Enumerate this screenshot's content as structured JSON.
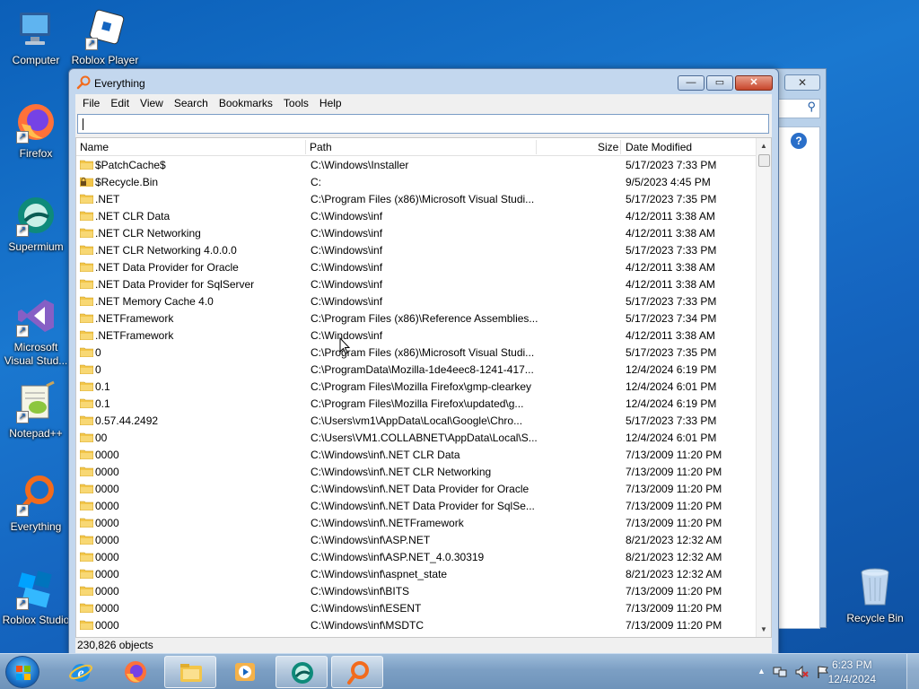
{
  "desktop": {
    "icons": [
      {
        "label": "Computer",
        "icon": "computer-icon"
      },
      {
        "label": "Roblox Player",
        "icon": "roblox-player-icon"
      },
      {
        "label": "Firefox",
        "icon": "firefox-icon"
      },
      {
        "label": "Supermium",
        "icon": "supermium-icon"
      },
      {
        "label": "Microsoft Visual Stud...",
        "icon": "visual-studio-icon"
      },
      {
        "label": "Notepad++",
        "icon": "notepadpp-icon"
      },
      {
        "label": "Everything",
        "icon": "everything-icon"
      },
      {
        "label": "Roblox Studio",
        "icon": "roblox-studio-icon"
      },
      {
        "label": "Recycle Bin",
        "icon": "recycle-bin-icon"
      }
    ]
  },
  "window": {
    "title": "Everything",
    "close_glyph": "✕",
    "maximize_glyph": "▭",
    "minimize_glyph": "—"
  },
  "menu": [
    "File",
    "Edit",
    "View",
    "Search",
    "Bookmarks",
    "Tools",
    "Help"
  ],
  "search": {
    "value": ""
  },
  "columns": {
    "name": "Name",
    "path": "Path",
    "size": "Size",
    "date": "Date Modified"
  },
  "rows": [
    {
      "name": "$PatchCache$",
      "path": "C:\\Windows\\Installer",
      "date": "5/17/2023 7:33 PM"
    },
    {
      "name": "$Recycle.Bin",
      "path": "C:",
      "date": "9/5/2023 4:45 PM",
      "locked": true
    },
    {
      "name": ".NET",
      "path": "C:\\Program Files (x86)\\Microsoft Visual Studi...",
      "date": "5/17/2023 7:35 PM"
    },
    {
      "name": ".NET CLR Data",
      "path": "C:\\Windows\\inf",
      "date": "4/12/2011 3:38 AM"
    },
    {
      "name": ".NET CLR Networking",
      "path": "C:\\Windows\\inf",
      "date": "4/12/2011 3:38 AM"
    },
    {
      "name": ".NET CLR Networking 4.0.0.0",
      "path": "C:\\Windows\\inf",
      "date": "5/17/2023 7:33 PM"
    },
    {
      "name": ".NET Data Provider for Oracle",
      "path": "C:\\Windows\\inf",
      "date": "4/12/2011 3:38 AM"
    },
    {
      "name": ".NET Data Provider for SqlServer",
      "path": "C:\\Windows\\inf",
      "date": "4/12/2011 3:38 AM"
    },
    {
      "name": ".NET Memory Cache 4.0",
      "path": "C:\\Windows\\inf",
      "date": "5/17/2023 7:33 PM"
    },
    {
      "name": ".NETFramework",
      "path": "C:\\Program Files (x86)\\Reference Assemblies...",
      "date": "5/17/2023 7:34 PM"
    },
    {
      "name": ".NETFramework",
      "path": "C:\\Windows\\inf",
      "date": "4/12/2011 3:38 AM"
    },
    {
      "name": "0",
      "path": "C:\\Program Files (x86)\\Microsoft Visual Studi...",
      "date": "5/17/2023 7:35 PM"
    },
    {
      "name": "0",
      "path": "C:\\ProgramData\\Mozilla-1de4eec8-1241-417...",
      "date": "12/4/2024 6:19 PM"
    },
    {
      "name": "0.1",
      "path": "C:\\Program Files\\Mozilla Firefox\\gmp-clearkey",
      "date": "12/4/2024 6:01 PM"
    },
    {
      "name": "0.1",
      "path": "C:\\Program Files\\Mozilla Firefox\\updated\\g...",
      "date": "12/4/2024 6:19 PM"
    },
    {
      "name": "0.57.44.2492",
      "path": "C:\\Users\\vm1\\AppData\\Local\\Google\\Chro...",
      "date": "5/17/2023 7:33 PM"
    },
    {
      "name": "00",
      "path": "C:\\Users\\VM1.COLLABNET\\AppData\\Local\\S...",
      "date": "12/4/2024 6:01 PM"
    },
    {
      "name": "0000",
      "path": "C:\\Windows\\inf\\.NET CLR Data",
      "date": "7/13/2009 11:20 PM"
    },
    {
      "name": "0000",
      "path": "C:\\Windows\\inf\\.NET CLR Networking",
      "date": "7/13/2009 11:20 PM"
    },
    {
      "name": "0000",
      "path": "C:\\Windows\\inf\\.NET Data Provider for Oracle",
      "date": "7/13/2009 11:20 PM"
    },
    {
      "name": "0000",
      "path": "C:\\Windows\\inf\\.NET Data Provider for SqlSe...",
      "date": "7/13/2009 11:20 PM"
    },
    {
      "name": "0000",
      "path": "C:\\Windows\\inf\\.NETFramework",
      "date": "7/13/2009 11:20 PM"
    },
    {
      "name": "0000",
      "path": "C:\\Windows\\inf\\ASP.NET",
      "date": "8/21/2023 12:32 AM"
    },
    {
      "name": "0000",
      "path": "C:\\Windows\\inf\\ASP.NET_4.0.30319",
      "date": "8/21/2023 12:32 AM"
    },
    {
      "name": "0000",
      "path": "C:\\Windows\\inf\\aspnet_state",
      "date": "8/21/2023 12:32 AM"
    },
    {
      "name": "0000",
      "path": "C:\\Windows\\inf\\BITS",
      "date": "7/13/2009 11:20 PM"
    },
    {
      "name": "0000",
      "path": "C:\\Windows\\inf\\ESENT",
      "date": "7/13/2009 11:20 PM"
    },
    {
      "name": "0000",
      "path": "C:\\Windows\\inf\\MSDTC",
      "date": "7/13/2009 11:20 PM"
    }
  ],
  "status": {
    "objects": "230,826 objects"
  },
  "taskbar": {
    "items": [
      {
        "icon": "internet-explorer-icon"
      },
      {
        "icon": "firefox-icon"
      },
      {
        "icon": "file-explorer-icon"
      },
      {
        "icon": "media-player-icon"
      },
      {
        "icon": "supermium-icon"
      },
      {
        "icon": "everything-icon"
      }
    ],
    "clock_time": "6:23 PM",
    "clock_date": "12/4/2024",
    "tray_arrow": "▲"
  },
  "colors": {
    "folder": "#f3c64a",
    "accent": "#1565c0",
    "close": "#c7452a"
  }
}
